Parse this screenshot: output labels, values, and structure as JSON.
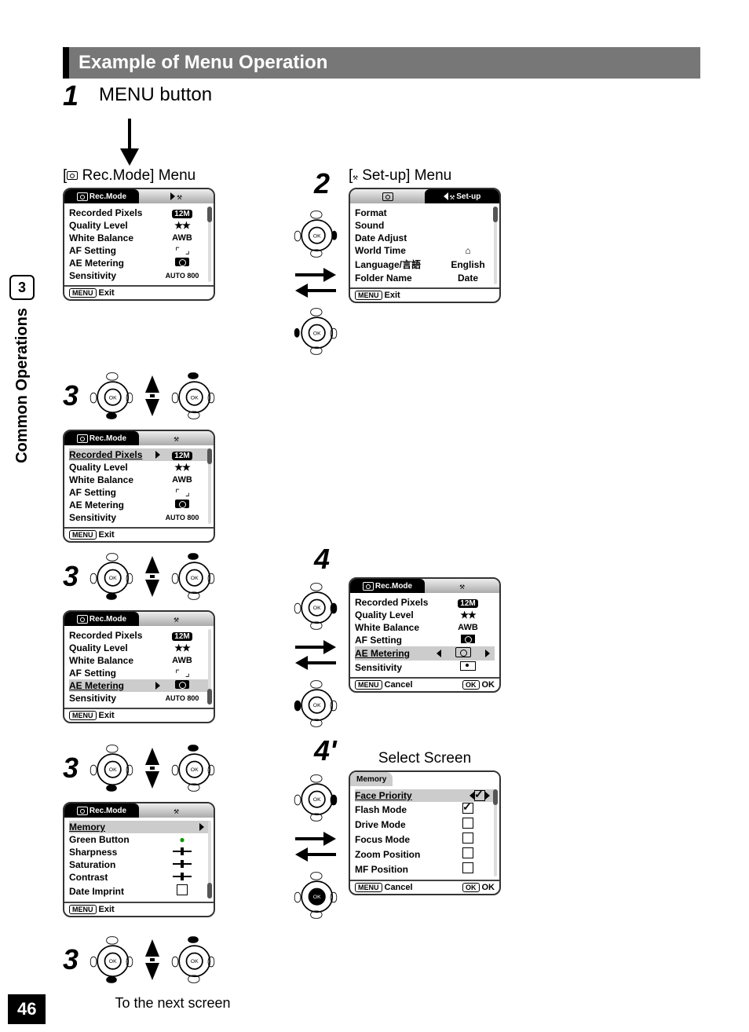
{
  "page_number": "46",
  "side_tab": {
    "index": "3",
    "title": "Common Operations"
  },
  "heading": "Example of Menu Operation",
  "steps": {
    "s1": {
      "num": "1",
      "text": "MENU button"
    },
    "s2": {
      "num": "2"
    },
    "s3": {
      "num": "3"
    },
    "s4": {
      "num": "4"
    },
    "s4p": {
      "num": "4'"
    }
  },
  "labels": {
    "rec_menu": "Rec.Mode] Menu",
    "setup_menu": "Set-up] Menu",
    "select_screen": "Select Screen",
    "to_next": "To the next screen"
  },
  "lcd_common": {
    "menu_btn": "MENU",
    "ok_btn": "OK",
    "exit": "Exit",
    "cancel": "Cancel",
    "ok": "OK"
  },
  "rec_tab": "Rec.Mode",
  "setup_tab": "Set-up",
  "rec_items": {
    "recorded_pixels": "Recorded Pixels",
    "quality_level": "Quality Level",
    "white_balance": "White Balance",
    "af_setting": "AF Setting",
    "ae_metering": "AE Metering",
    "sensitivity": "Sensitivity"
  },
  "rec_vals": {
    "recorded_pixels": "12M",
    "quality_level": "★★",
    "white_balance": "AWB",
    "sensitivity": "AUTO 800"
  },
  "rec_page2": {
    "memory": "Memory",
    "green_button": "Green Button",
    "sharpness": "Sharpness",
    "saturation": "Saturation",
    "contrast": "Contrast",
    "date_imprint": "Date Imprint"
  },
  "setup_items": {
    "format": "Format",
    "sound": "Sound",
    "date_adjust": "Date Adjust",
    "world_time": "World Time",
    "language": "Language/言語",
    "folder_name": "Folder Name"
  },
  "setup_vals": {
    "language": "English",
    "folder_name": "Date"
  },
  "memory_screen": {
    "title": "Memory",
    "face_priority": "Face Priority",
    "flash_mode": "Flash Mode",
    "drive_mode": "Drive Mode",
    "focus_mode": "Focus Mode",
    "zoom_position": "Zoom Position",
    "mf_position": "MF Position"
  },
  "dpad_ok": "OK"
}
